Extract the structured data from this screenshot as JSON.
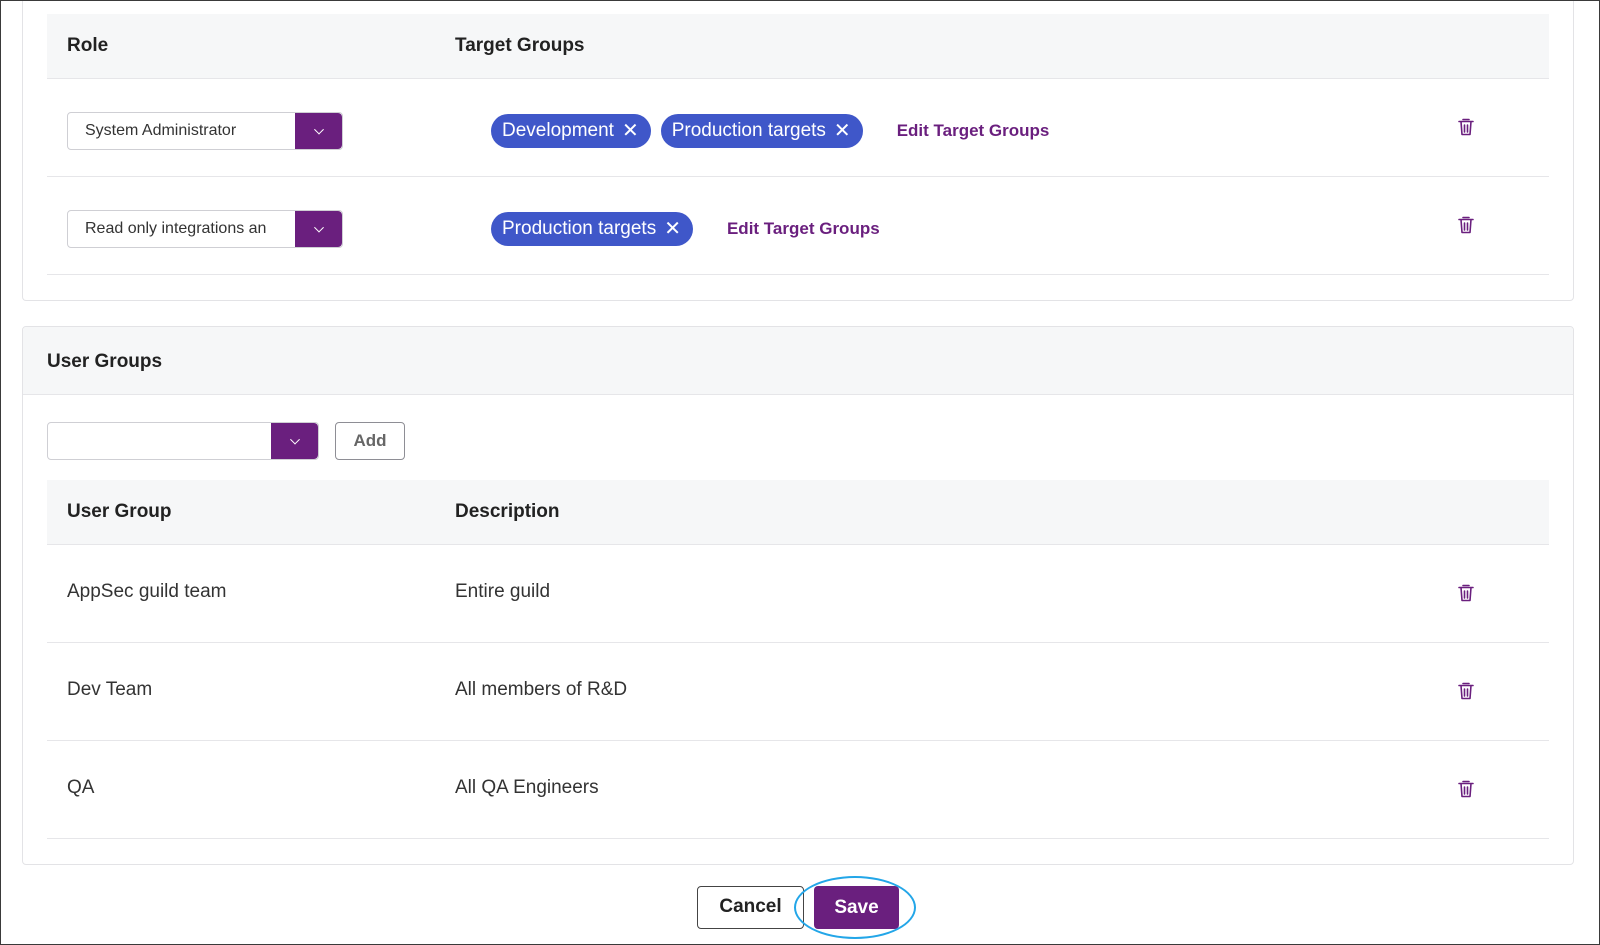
{
  "roles_table": {
    "headers": {
      "role": "Role",
      "target_groups": "Target Groups"
    },
    "rows": [
      {
        "role": "System Administrator",
        "target_groups": [
          "Development",
          "Production targets"
        ],
        "edit_label": "Edit Target Groups"
      },
      {
        "role": "Read only integrations an",
        "target_groups": [
          "Production targets"
        ],
        "edit_label": "Edit Target Groups"
      }
    ]
  },
  "user_groups": {
    "title": "User Groups",
    "select_value": "",
    "add_label": "Add",
    "headers": {
      "user_group": "User Group",
      "description": "Description"
    },
    "rows": [
      {
        "name": "AppSec guild team",
        "description": "Entire guild"
      },
      {
        "name": "Dev Team",
        "description": "All members of R&D"
      },
      {
        "name": "QA",
        "description": "All QA Engineers"
      }
    ]
  },
  "footer": {
    "cancel_label": "Cancel",
    "save_label": "Save"
  },
  "colors": {
    "accent": "#6a1f7e",
    "chip": "#3f57c9",
    "highlight": "#23a6e8",
    "header_bg": "#f6f7f8"
  },
  "icons": {
    "delete": "trash-icon",
    "dropdown": "chevron-down-icon",
    "remove_chip": "close-icon"
  }
}
